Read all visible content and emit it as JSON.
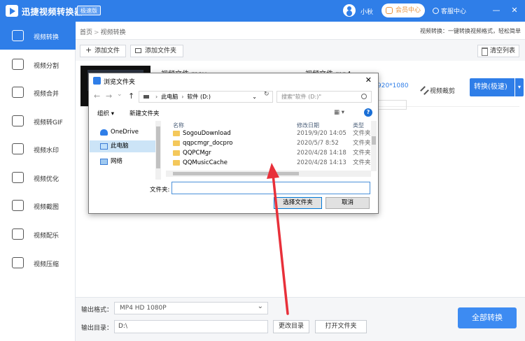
{
  "app": {
    "title": "迅捷视频转换器",
    "edition": "极速版",
    "username": "小秋",
    "vip": "会员中心",
    "service": "客服中心",
    "window_min": "—",
    "window_close": "✕"
  },
  "sidebar": {
    "items": [
      {
        "label": "视频转换",
        "icon": "video-convert-icon"
      },
      {
        "label": "视频分割",
        "icon": "video-split-icon"
      },
      {
        "label": "视频合并",
        "icon": "video-merge-icon"
      },
      {
        "label": "视频转GIF",
        "icon": "gif-icon"
      },
      {
        "label": "视频水印",
        "icon": "watermark-icon"
      },
      {
        "label": "视频优化",
        "icon": "optimize-icon"
      },
      {
        "label": "视频截图",
        "icon": "screenshot-icon"
      },
      {
        "label": "视频配乐",
        "icon": "music-icon"
      },
      {
        "label": "视频压缩",
        "icon": "compress-icon"
      }
    ],
    "active_index": 0
  },
  "breadcrumb": {
    "home": "首页",
    "separator": ">",
    "current": "视频转换"
  },
  "tip": "视频转换：一键转换视频格式，轻松简单",
  "toolbar": {
    "add_file": "添加文件",
    "add_folder": "添加文件夹",
    "clear": "清空列表"
  },
  "file": {
    "source_name": "视频文件.mov",
    "target_name": "视频文件.mp4",
    "resolution": "920*1080",
    "clip": "视频裁剪",
    "convert": "转换(极速)",
    "convert_dropdown": "▾"
  },
  "bottom": {
    "format_label": "输出格式：",
    "format_value": "MP4   HD 1080P",
    "dir_label": "输出目录：",
    "dir_value": "D:\\",
    "change_dir": "更改目录",
    "open_folder": "打开文件夹",
    "convert_all": "全部转换"
  },
  "dialog": {
    "title": "浏览文件夹",
    "close": "✕",
    "nav_back": "←",
    "nav_forward": "→",
    "nav_recent": "⌄",
    "nav_up": "↑",
    "address": [
      "此电脑",
      "软件 (D:)"
    ],
    "address_dropdown": "⌄",
    "refresh": "↻",
    "search_placeholder": "搜索\"软件 (D:)\"",
    "organize": "组织 ▾",
    "new_folder": "新建文件夹",
    "view": "▦ ▾",
    "help": "?",
    "tree": [
      {
        "label": "OneDrive",
        "icon": "onedrive-icon"
      },
      {
        "label": "此电脑",
        "icon": "computer-icon"
      },
      {
        "label": "网络",
        "icon": "network-icon"
      }
    ],
    "columns": {
      "name": "名称",
      "date": "修改日期",
      "type": "类型"
    },
    "files": [
      {
        "name": "SogouDownload",
        "date": "2019/9/20 14:05",
        "type": "文件夹"
      },
      {
        "name": "qqpcmgr_docpro",
        "date": "2020/5/7 8:52",
        "type": "文件夹"
      },
      {
        "name": "QQPCMgr",
        "date": "2020/4/28 14:18",
        "type": "文件夹"
      },
      {
        "name": "QQMusicCache",
        "date": "2020/4/28 14:13",
        "type": "文件夹"
      }
    ],
    "folder_label": "文件夹:",
    "folder_value": "",
    "select_btn": "选择文件夹",
    "cancel_btn": "取消"
  },
  "colors": {
    "brand": "#2f7ee8",
    "annotation_arrow": "#e8303a"
  }
}
